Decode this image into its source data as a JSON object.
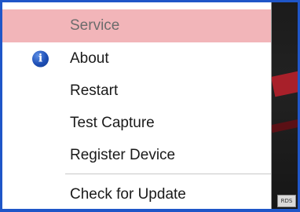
{
  "menu": {
    "header_label": "Service",
    "items": [
      {
        "label": "About",
        "icon": "info-icon"
      },
      {
        "label": "Restart"
      },
      {
        "label": "Test Capture"
      },
      {
        "label": "Register Device"
      },
      {
        "label": "Check for Update"
      }
    ],
    "info_icon_glyph": "i"
  },
  "tray": {
    "icon_text": "RDS"
  },
  "colors": {
    "header_highlight": "#f2b5b9",
    "frame_border": "#1f56c8",
    "info_icon": "#1e4fb6"
  }
}
